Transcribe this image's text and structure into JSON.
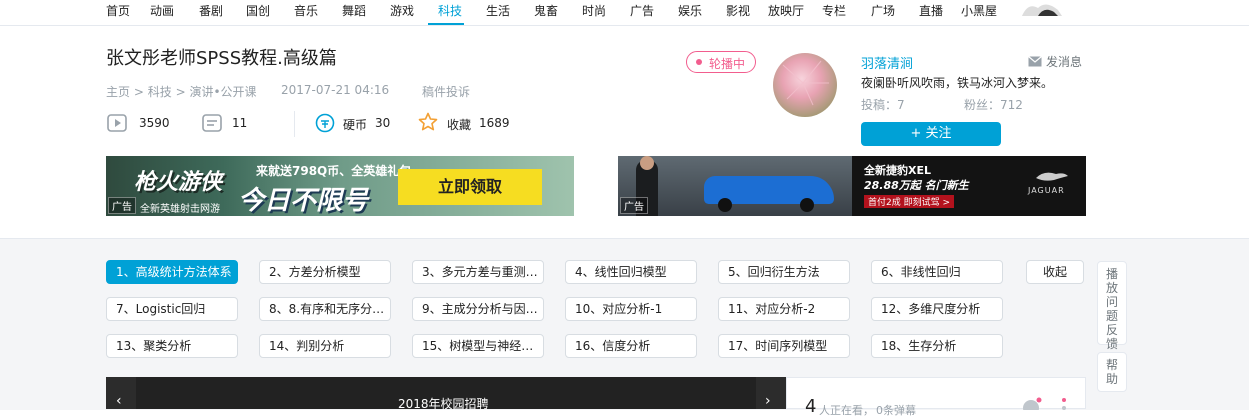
{
  "nav": {
    "items": [
      "首页",
      "动画",
      "番剧",
      "国创",
      "音乐",
      "舞蹈",
      "游戏",
      "科技",
      "生活",
      "鬼畜",
      "时尚",
      "广告",
      "娱乐",
      "影视",
      "放映厅",
      "专栏",
      "广场",
      "直播",
      "小黑屋"
    ],
    "active": "科技"
  },
  "video": {
    "title": "张文彤老师SPSS教程.高级篇",
    "breadcrumb": [
      "主页",
      "科技",
      "演讲•公开课"
    ],
    "breadcrumb_sep": ">",
    "publish_time": "2017-07-21 04:16",
    "report_label": "稿件投诉",
    "stats": {
      "plays": "3590",
      "danmaku": "11",
      "coin_label": "硬币",
      "coins": "30",
      "fav_label": "收藏",
      "favs": "1689"
    }
  },
  "ads": {
    "left": {
      "label": "广告",
      "brand": "枪火游侠",
      "slogan_top": "来就送798Q币、全英雄礼包",
      "slogan_big": "今日不限号",
      "cta": "立即领取",
      "subtitle": "全新英雄射击网游"
    },
    "right": {
      "label": "广告",
      "headline": "全新捷豹XEL",
      "price_line": "28.88万起 名门新生",
      "sub_line": "首付2成 即刻试驾 >",
      "brand": "JAGUAR"
    }
  },
  "uploader": {
    "live_badge": "轮播中",
    "name": "羽落清涧",
    "message_label": "发消息",
    "signature": "夜阑卧听风吹雨，铁马冰河入梦来。",
    "uploads_label": "投稿：7",
    "fans_label": "粉丝：712",
    "follow_label": "+ 关注"
  },
  "episodes": {
    "items": [
      "1、高级统计方法体系",
      "2、方差分析模型",
      "3、多元方差与重测…",
      "4、线性回归模型",
      "5、回归衍生方法",
      "6、非线性回归",
      "7、Logistic回归",
      "8、8.有序和无序分…",
      "9、主成分分析与因…",
      "10、对应分析-1",
      "11、对应分析-2",
      "12、多维尺度分析",
      "13、聚类分析",
      "14、判别分析",
      "15、树模型与神经…",
      "16、信度分析",
      "17、时间序列模型",
      "18、生存分析"
    ],
    "active_index": 0,
    "collapse_label": "收起"
  },
  "side": {
    "feedback": "播放问题反馈",
    "help": "帮助"
  },
  "player": {
    "title": "2018年校园招聘",
    "prev": "‹",
    "next": "›"
  },
  "danmaku_panel": {
    "watching_count": "4",
    "watching_label": "人正在看，",
    "danmaku_label": "0条弹幕"
  },
  "colors": {
    "accent": "#00a1d6",
    "live_pink": "#f25d8e"
  }
}
